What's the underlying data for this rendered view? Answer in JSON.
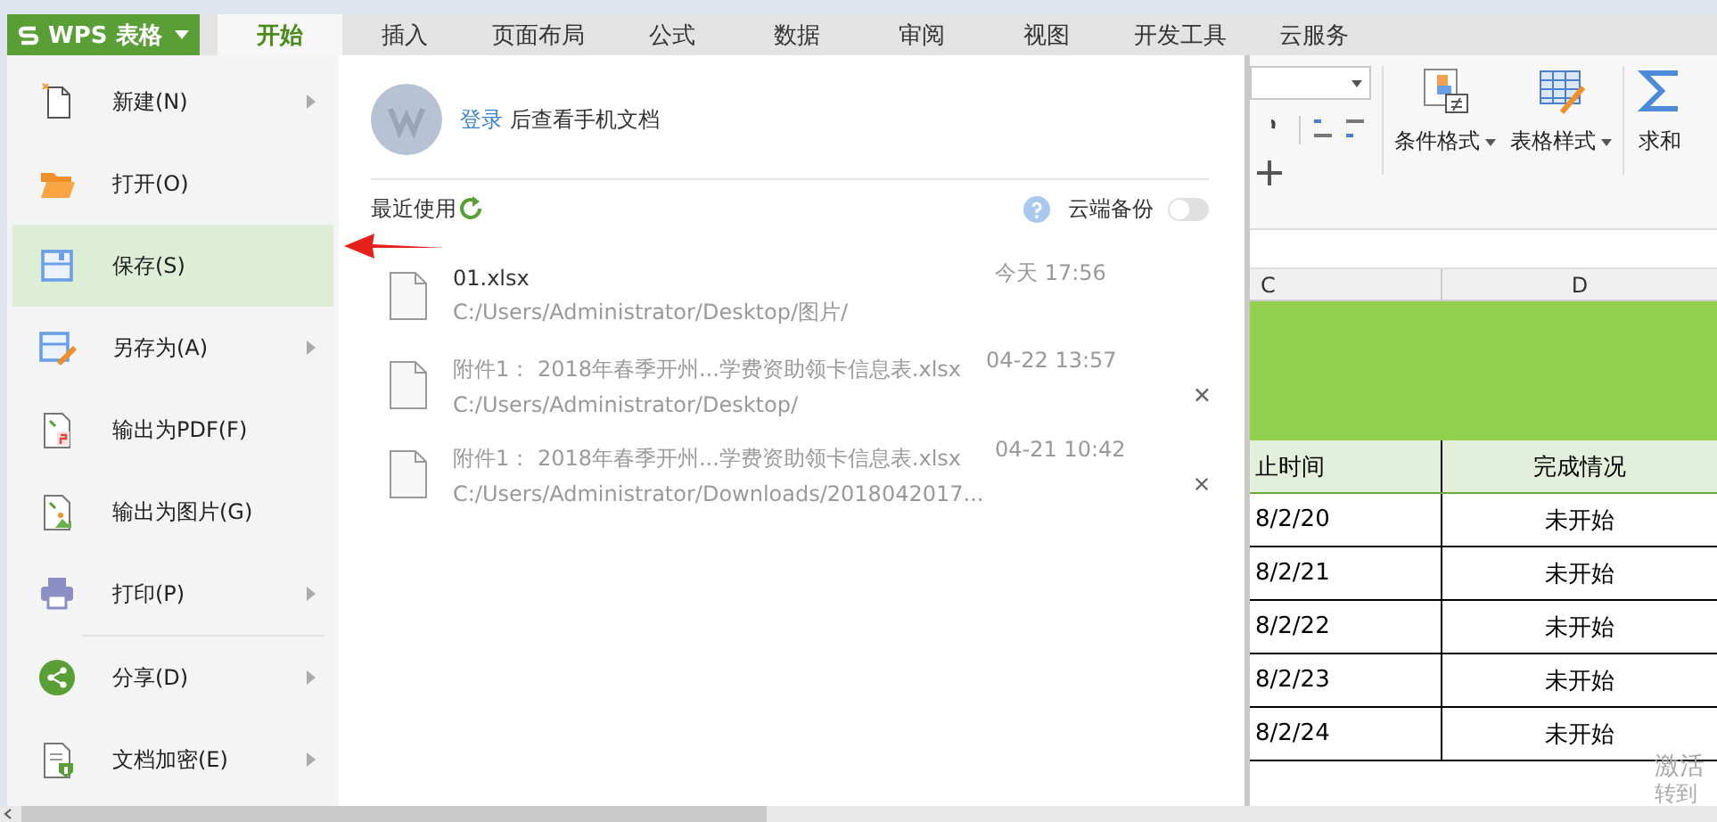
{
  "app": {
    "title": "WPS 表格"
  },
  "tabs": [
    {
      "label": "开始",
      "selected": true
    },
    {
      "label": "插入",
      "selected": false
    },
    {
      "label": "页面布局",
      "selected": false
    },
    {
      "label": "公式",
      "selected": false
    },
    {
      "label": "数据",
      "selected": false
    },
    {
      "label": "审阅",
      "selected": false
    },
    {
      "label": "视图",
      "selected": false
    },
    {
      "label": "开发工具",
      "selected": false
    },
    {
      "label": "云服务",
      "selected": false
    }
  ],
  "menu": {
    "groups": [
      [
        {
          "label": "新建(N)",
          "kind": "new",
          "submenu": true,
          "selected": false
        },
        {
          "label": "打开(O)",
          "kind": "open",
          "submenu": false,
          "selected": false
        },
        {
          "label": "保存(S)",
          "kind": "save",
          "submenu": false,
          "selected": true
        },
        {
          "label": "另存为(A)",
          "kind": "saveas",
          "submenu": true,
          "selected": false
        },
        {
          "label": "输出为PDF(F)",
          "kind": "pdf",
          "submenu": false,
          "selected": false
        },
        {
          "label": "输出为图片(G)",
          "kind": "image",
          "submenu": false,
          "selected": false
        },
        {
          "label": "打印(P)",
          "kind": "print",
          "submenu": true,
          "selected": false
        }
      ],
      [
        {
          "label": "分享(D)",
          "kind": "share",
          "submenu": true,
          "selected": false
        },
        {
          "label": "文档加密(E)",
          "kind": "lock",
          "submenu": true,
          "selected": false
        }
      ]
    ]
  },
  "account": {
    "link": "登录",
    "text": "后查看手机文档"
  },
  "recent": {
    "title": "最近使用",
    "cloud_backup": {
      "label": "云端备份",
      "on": false
    },
    "files": [
      {
        "name": "01.xlsx",
        "path": "C:/Users/Administrator/Desktop/图片/",
        "time": "今天 17:56",
        "dimmed": false,
        "removable": false
      },
      {
        "name": "附件1： 2018年春季开州...学费资助领卡信息表.xlsx",
        "path": "C:/Users/Administrator/Desktop/",
        "time": "04-22 13:57",
        "dimmed": true,
        "removable": true
      },
      {
        "name": "附件1： 2018年春季开州...学费资助领卡信息表.xlsx",
        "path": "C:/Users/Administrator/Downloads/2018042017...",
        "time": "04-21 10:42",
        "dimmed": true,
        "removable": true
      }
    ]
  },
  "ribbon": {
    "buttons": [
      {
        "label": "条件格式",
        "kind": "cond",
        "dropdown": true
      },
      {
        "label": "表格样式",
        "kind": "style",
        "dropdown": true
      },
      {
        "label": "求和",
        "kind": "sum",
        "dropdown": false
      }
    ]
  },
  "sheet": {
    "columns": [
      "C",
      "D"
    ],
    "header": [
      "止时间",
      "完成情况"
    ],
    "rows": [
      [
        "8/2/20",
        "未开始"
      ],
      [
        "8/2/21",
        "未开始"
      ],
      [
        "8/2/22",
        "未开始"
      ],
      [
        "8/2/23",
        "未开始"
      ],
      [
        "8/2/24",
        "未开始"
      ]
    ]
  },
  "activation": [
    "激活",
    "转到"
  ]
}
